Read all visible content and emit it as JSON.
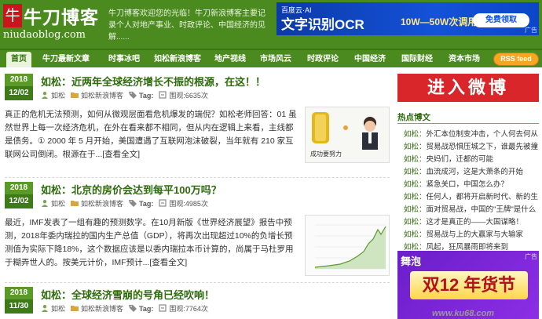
{
  "header": {
    "logo_char": "牛",
    "site_name": "牛刀博客",
    "domain": "niudaoblog.com",
    "description": "牛刀博客欢迎您的光临！牛刀新浪博客主要记录个人对地产事业、时政评论、中国经济的见解......"
  },
  "top_ad": {
    "brand": "百度云·AI",
    "title": "文字识别OCR",
    "subtitle": "10W—50W次调用",
    "button": "免费领取",
    "tag": "广告"
  },
  "nav": {
    "items": [
      {
        "label": "首页"
      },
      {
        "label": "牛刀最新文章"
      },
      {
        "label": "时事冰吧"
      },
      {
        "label": "如松新浪博客"
      },
      {
        "label": "地产视线"
      },
      {
        "label": "市场风云"
      },
      {
        "label": "时政评论"
      },
      {
        "label": "中国经济"
      },
      {
        "label": "国际财经"
      },
      {
        "label": "资本市场"
      }
    ],
    "rss": "RSS feed"
  },
  "posts": [
    {
      "year": "2018",
      "day": "12/02",
      "title": "如松：近两年全球经济增长不振的根源，在这！！",
      "author": "如松",
      "category": "如松新浪博客",
      "tag_label": "Tag:",
      "views": "围观:6635次",
      "excerpt": "真正的危机无法预测，如何从微观层面看危机爆发的端倪？如松老师回答：01 虽然世界上每一次经济危机，在外在看来都不相同，但从内在逻辑上来看，主线都是债务。① 2000 年 5 月开始，美国遭遇了互联网泡沫破裂，当年就有 210 家互联网公司倒闭。根源在于...",
      "readmore": "[查看全文]"
    },
    {
      "year": "2018",
      "day": "12/02",
      "title": "如松：北京的房价会达到每平100万吗？",
      "author": "如松",
      "category": "如松新浪博客",
      "tag_label": "Tag:",
      "views": "围观:4985次",
      "excerpt": "最近，IMF发表了一组有趣的预测数字。在10月新版《世界经济展望》报告中预测，2018年委内瑞拉的国内生产总值（GDP），将再次出现超过10%的负增长预测值为实际下降18%，这个数据应该是以委内瑞拉本币计算的，尚属于马杜罗用于糊弄世人的。按美元计价，IMF预计...",
      "readmore": "[查看全文]"
    },
    {
      "year": "2018",
      "day": "11/30",
      "title": "如松：全球经济雪崩的号角已经吹响！",
      "author": "如松",
      "category": "如松新浪博客",
      "tag_label": "Tag:",
      "views": "围观:7764次"
    }
  ],
  "thumb1": {
    "caption": "成功要努力"
  },
  "sidebar": {
    "weibo": "进入微博",
    "hot_title": "热点博文",
    "hot_items": [
      {
        "cat": "如松：",
        "text": "外汇本位制变冲击，个人何去何从"
      },
      {
        "cat": "如松：",
        "text": "贸易战恐惧压城之下，谁最先被撞"
      },
      {
        "cat": "如松：",
        "text": "央妈们，迁都的可能"
      },
      {
        "cat": "如松：",
        "text": "血流成河，这是大萧条的开始"
      },
      {
        "cat": "如松：",
        "text": "紧急关口，中国怎么办？"
      },
      {
        "cat": "如松：",
        "text": "任何人，都将开启新时代、新的生"
      },
      {
        "cat": "如松：",
        "text": "面对贸易战，中国的\"王牌\"是什么"
      },
      {
        "cat": "如松：",
        "text": "这才是真正的——大国谋略！"
      },
      {
        "cat": "如松：",
        "text": "贸易战与上的大赢家与大输家"
      },
      {
        "cat": "如松：",
        "text": "风起，狂风暴雨即将来到"
      }
    ],
    "ad2": {
      "brand": "舞泡",
      "tag": "广告",
      "main": "双12 年货节"
    },
    "watermark": "www.ku68.com"
  },
  "colors": {
    "brand_green": "#4a8a1e",
    "title_green": "#2d6b0c",
    "weibo_red": "#d9262a",
    "rss_orange": "#f5a623"
  }
}
